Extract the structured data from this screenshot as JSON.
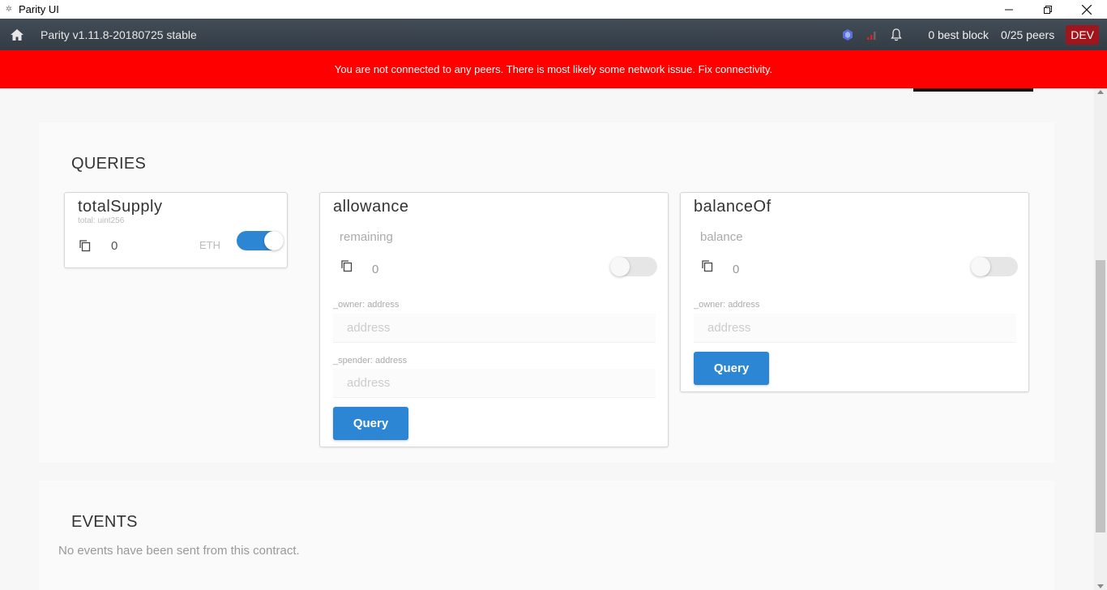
{
  "window": {
    "title": "Parity UI"
  },
  "header": {
    "version": "Parity v1.11.8-20180725 stable",
    "best_block": "0 best block",
    "peers": "0/25 peers",
    "chain_badge": "DEV"
  },
  "alert": {
    "message": "You are not connected to any peers. There is most likely some network issue. Fix connectivity."
  },
  "queries": {
    "title": "QUERIES",
    "total_supply": {
      "name": "totalSupply",
      "output_label": "total: uint256",
      "value": "0",
      "unit": "ETH",
      "eth_toggle_on": true
    },
    "allowance": {
      "name": "allowance",
      "output_label": "remaining",
      "value": "0",
      "toggle_on": false,
      "owner_label": "_owner: address",
      "owner_placeholder": "address",
      "spender_label": "_spender: address",
      "spender_placeholder": "address",
      "query_label": "Query"
    },
    "balance_of": {
      "name": "balanceOf",
      "output_label": "balance",
      "value": "0",
      "toggle_on": false,
      "owner_label": "_owner: address",
      "owner_placeholder": "address",
      "query_label": "Query"
    }
  },
  "events": {
    "title": "EVENTS",
    "empty_message": "No events have been sent from this contract."
  },
  "colors": {
    "alert": "#ff0000",
    "primary": "#2d86d3",
    "header": "#3a434c",
    "dev_badge": "#a0141c"
  }
}
